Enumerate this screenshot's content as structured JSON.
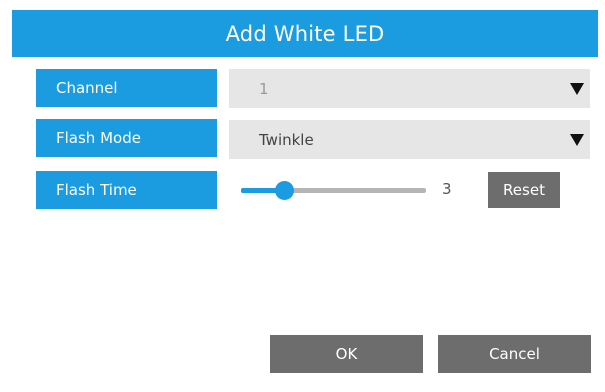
{
  "dialog": {
    "title": "Add White LED"
  },
  "fields": {
    "channel": {
      "label": "Channel",
      "value": "1"
    },
    "flash_mode": {
      "label": "Flash Mode",
      "value": "Twinkle"
    },
    "flash_time": {
      "label": "Flash Time",
      "value": "3",
      "slider_fraction": 0.24
    }
  },
  "buttons": {
    "reset": "Reset",
    "ok": "OK",
    "cancel": "Cancel"
  },
  "colors": {
    "accent": "#1b9be0",
    "button_gray": "#6d6d6d",
    "select_bg": "#e6e6e6"
  },
  "icons": {
    "dropdown": "caret-down-icon"
  }
}
